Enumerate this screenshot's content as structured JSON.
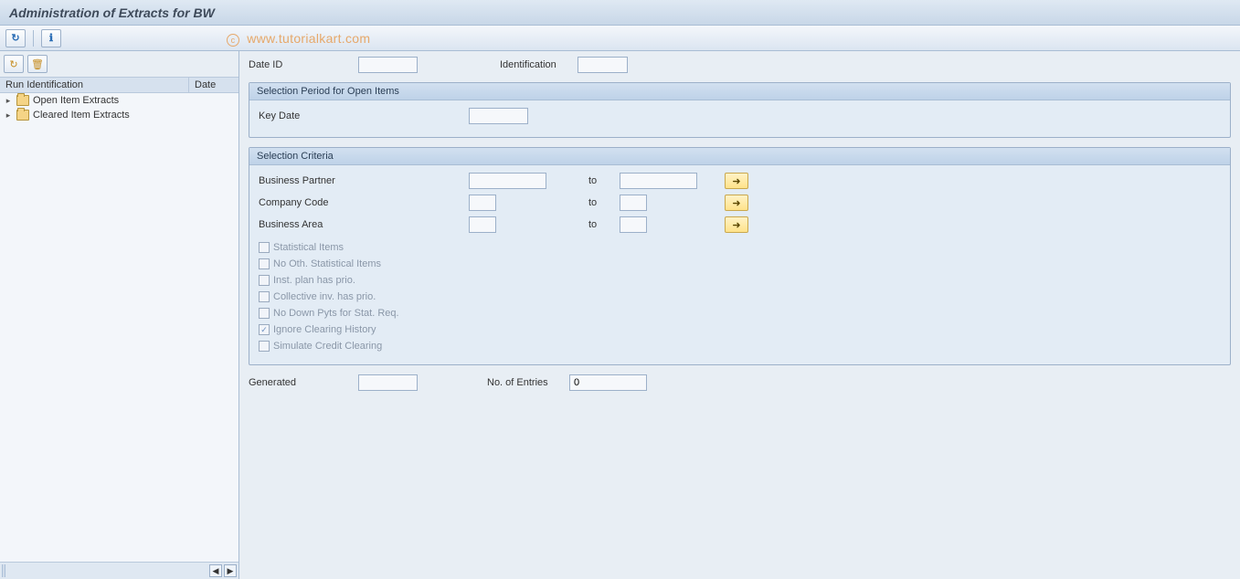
{
  "title": "Administration of Extracts for BW",
  "watermark": "www.tutorialkart.com",
  "tree": {
    "headers": {
      "col1": "Run Identification",
      "col2": "Date"
    },
    "items": [
      {
        "label": "Open Item Extracts"
      },
      {
        "label": "Cleared Item Extracts"
      }
    ]
  },
  "top": {
    "dateid_label": "Date ID",
    "dateid_value": "",
    "ident_label": "Identification",
    "ident_value": ""
  },
  "group_period": {
    "title": "Selection Period for Open Items",
    "keydate_label": "Key Date",
    "keydate_value": ""
  },
  "group_criteria": {
    "title": "Selection Criteria",
    "rows": [
      {
        "label": "Business Partner",
        "from": "",
        "to_label": "to",
        "to": ""
      },
      {
        "label": "Company Code",
        "from": "",
        "to_label": "to",
        "to": ""
      },
      {
        "label": "Business Area",
        "from": "",
        "to_label": "to",
        "to": ""
      }
    ],
    "checkboxes": [
      {
        "label": "Statistical Items",
        "checked": false
      },
      {
        "label": "No Oth. Statistical Items",
        "checked": false
      },
      {
        "label": "Inst. plan has prio.",
        "checked": false
      },
      {
        "label": "Collective inv. has prio.",
        "checked": false
      },
      {
        "label": "No Down Pyts for Stat. Req.",
        "checked": false
      },
      {
        "label": "Ignore Clearing History",
        "checked": true
      },
      {
        "label": "Simulate Credit Clearing",
        "checked": false
      }
    ]
  },
  "footer": {
    "generated_label": "Generated",
    "generated_value": "",
    "entries_label": "No. of Entries",
    "entries_value": "0"
  }
}
